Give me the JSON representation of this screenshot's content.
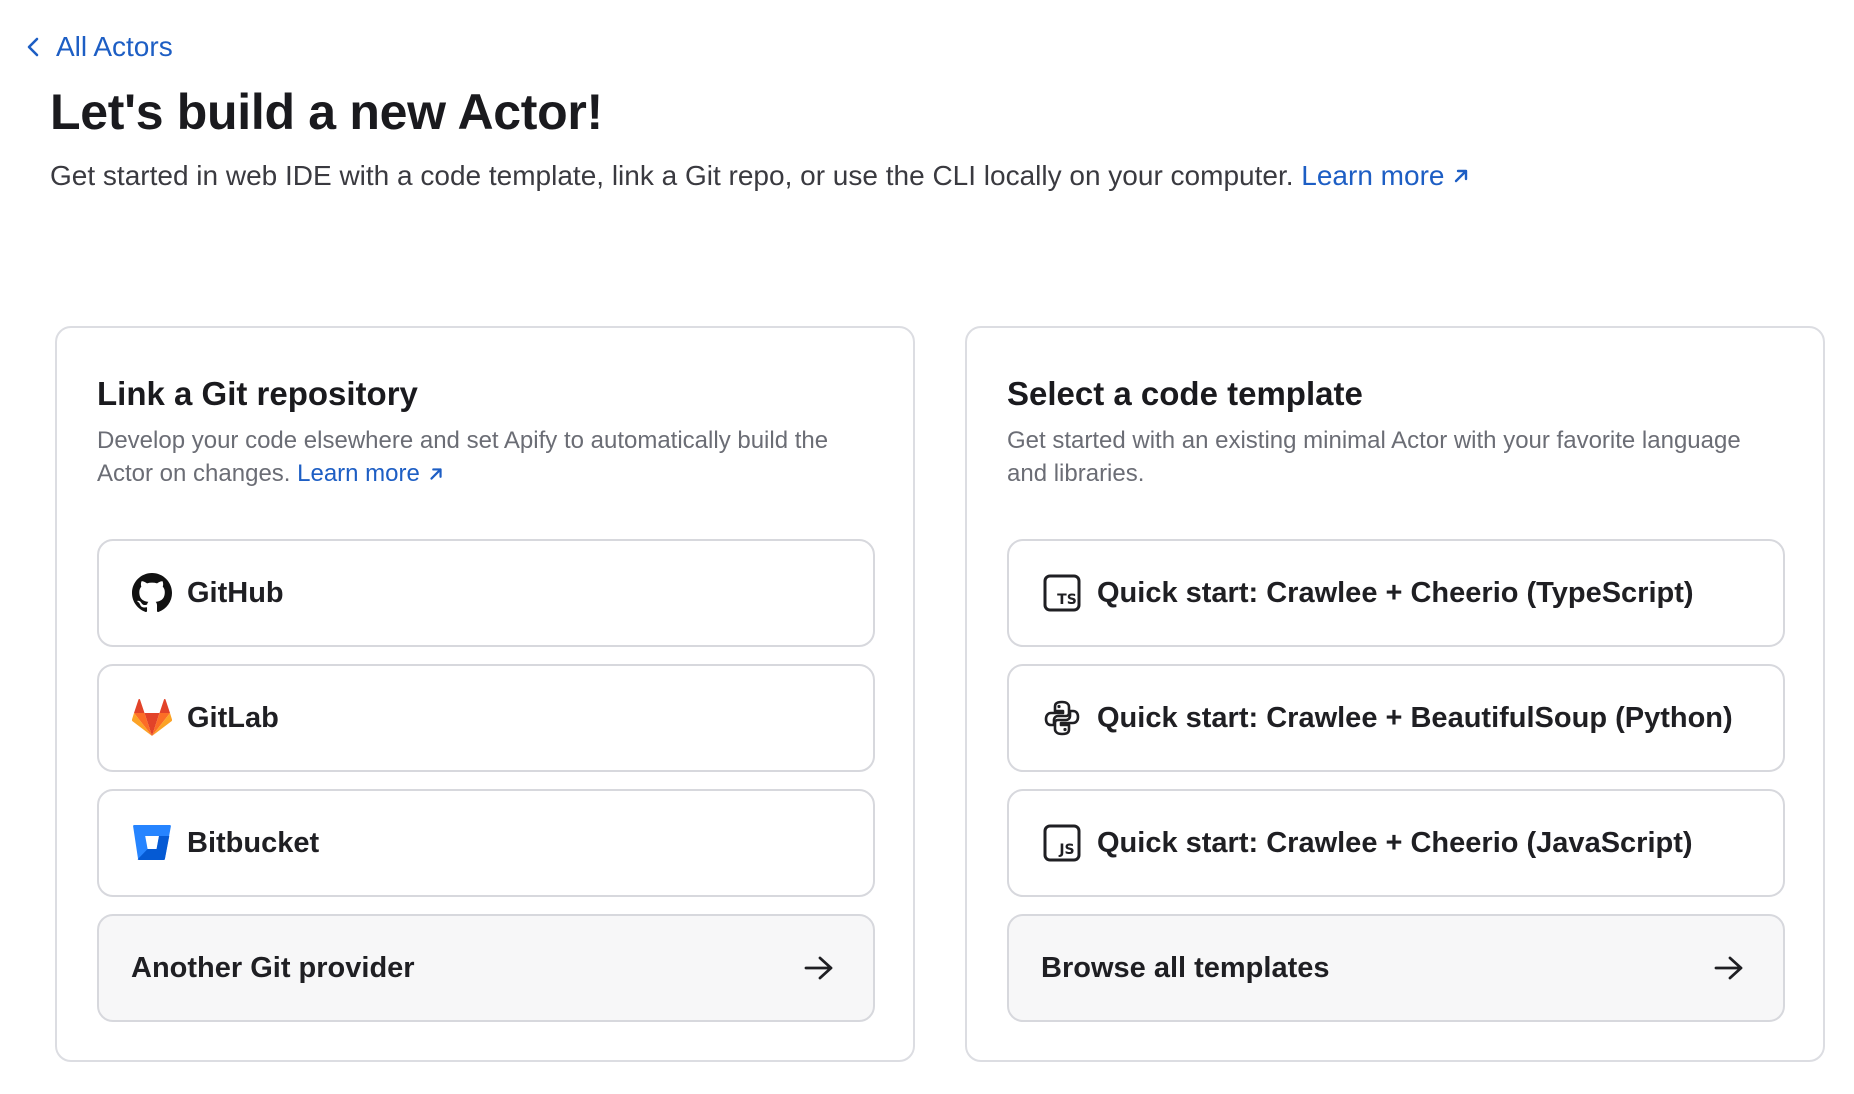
{
  "nav": {
    "back_label": "All Actors"
  },
  "header": {
    "title": "Let's build a new Actor!",
    "subtitle": "Get started in web IDE with a code template, link a Git repo, or use the CLI locally on your computer.",
    "learn_more": "Learn more"
  },
  "git_card": {
    "title": "Link a Git repository",
    "description": "Develop your code elsewhere and set Apify to automatically build the Actor on changes.",
    "learn_more": "Learn more",
    "options": [
      {
        "label": "GitHub",
        "icon": "github-icon"
      },
      {
        "label": "GitLab",
        "icon": "gitlab-icon"
      },
      {
        "label": "Bitbucket",
        "icon": "bitbucket-icon"
      }
    ],
    "more_label": "Another Git provider"
  },
  "template_card": {
    "title": "Select a code template",
    "description": "Get started with an existing minimal Actor with your favorite language and libraries.",
    "options": [
      {
        "label": "Quick start: Crawlee + Cheerio (TypeScript)",
        "icon": "typescript-icon"
      },
      {
        "label": "Quick start: Crawlee + BeautifulSoup (Python)",
        "icon": "python-icon"
      },
      {
        "label": "Quick start: Crawlee + Cheerio (JavaScript)",
        "icon": "javascript-icon"
      }
    ],
    "more_label": "Browse all templates"
  },
  "colors": {
    "link": "#1d5ec4",
    "border": "#dcdde2",
    "muted_text": "#6b6d75",
    "gitlab_orange": "#e24329",
    "bitbucket_blue": "#2684ff"
  }
}
